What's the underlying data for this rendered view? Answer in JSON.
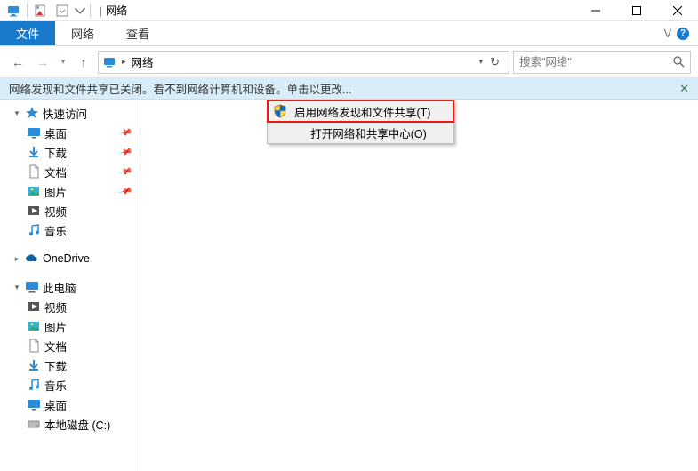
{
  "titlebar": {
    "title": "网络"
  },
  "ribbon": {
    "tabs": [
      {
        "label": "文件",
        "active": true
      },
      {
        "label": "网络",
        "active": false
      },
      {
        "label": "查看",
        "active": false
      }
    ]
  },
  "nav": {
    "breadcrumb_root": "网络",
    "refresh_glyph": "↻"
  },
  "search": {
    "placeholder": "搜索\"网络\""
  },
  "infobar": {
    "text": "网络发现和文件共享已关闭。看不到网络计算机和设备。单击以更改..."
  },
  "context_menu": {
    "items": [
      {
        "label": "启用网络发现和文件共享(T)",
        "shield": true,
        "highlighted": true
      },
      {
        "label": "打开网络和共享中心(O)",
        "shield": false,
        "highlighted": false
      }
    ]
  },
  "sidebar": {
    "quick_access": {
      "label": "快速访问",
      "items": [
        {
          "label": "桌面",
          "icon": "desktop",
          "pinned": true
        },
        {
          "label": "下载",
          "icon": "download",
          "pinned": true
        },
        {
          "label": "文档",
          "icon": "document",
          "pinned": true
        },
        {
          "label": "图片",
          "icon": "picture",
          "pinned": true
        },
        {
          "label": "视频",
          "icon": "video",
          "pinned": false
        },
        {
          "label": "音乐",
          "icon": "music",
          "pinned": false
        }
      ]
    },
    "onedrive": {
      "label": "OneDrive"
    },
    "this_pc": {
      "label": "此电脑",
      "items": [
        {
          "label": "视频",
          "icon": "video"
        },
        {
          "label": "图片",
          "icon": "picture"
        },
        {
          "label": "文档",
          "icon": "document"
        },
        {
          "label": "下载",
          "icon": "download"
        },
        {
          "label": "音乐",
          "icon": "music"
        },
        {
          "label": "桌面",
          "icon": "desktop"
        },
        {
          "label": "本地磁盘 (C:)",
          "icon": "drive"
        }
      ]
    }
  }
}
